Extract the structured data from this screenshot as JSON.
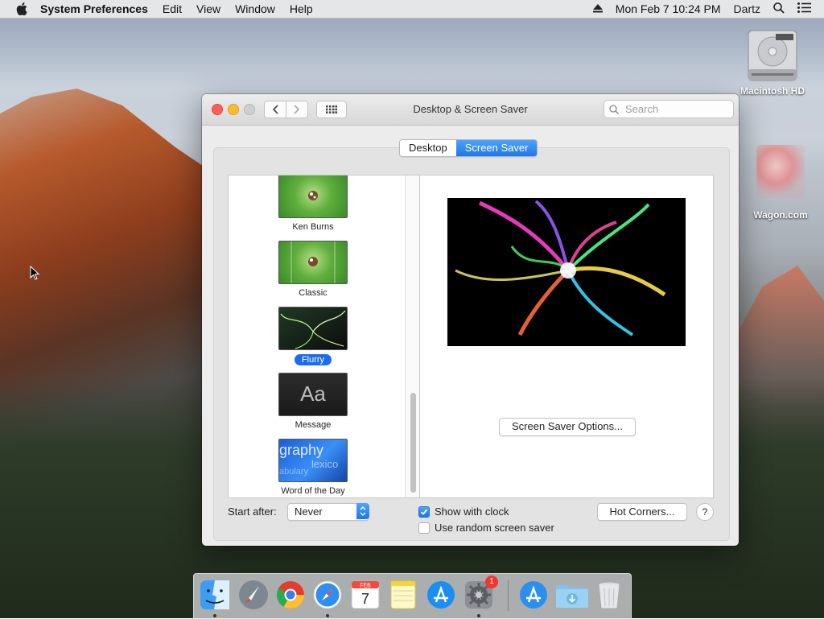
{
  "menubar": {
    "app_name": "System Preferences",
    "menus": [
      "Edit",
      "View",
      "Window",
      "Help"
    ],
    "datetime": "Mon Feb 7  10:24 PM",
    "user": "Dartz"
  },
  "desktop": {
    "icons": [
      {
        "label": "Macintosh HD"
      },
      {
        "label": "Wagon.com"
      }
    ]
  },
  "window": {
    "title": "Desktop & Screen Saver",
    "search_placeholder": "Search",
    "tabs": [
      {
        "label": "Desktop",
        "selected": false
      },
      {
        "label": "Screen Saver",
        "selected": true
      }
    ],
    "savers": [
      {
        "label": "Ken Burns",
        "selected": false
      },
      {
        "label": "Classic",
        "selected": false
      },
      {
        "label": "Flurry",
        "selected": true
      },
      {
        "label": "Message",
        "selected": false,
        "thumb_text": "Aa"
      },
      {
        "label": "Word of the Day",
        "selected": false,
        "thumb_words": [
          "graphy",
          "lexico",
          "abulary"
        ]
      }
    ],
    "options_button": "Screen Saver Options...",
    "start_after_label": "Start after:",
    "start_after_value": "Never",
    "show_with_clock": {
      "label": "Show with clock",
      "checked": true
    },
    "random_saver": {
      "label": "Use random screen saver",
      "checked": false
    },
    "hot_corners_button": "Hot Corners...",
    "help_button": "?"
  },
  "dock": {
    "items": [
      "Finder",
      "Launchpad",
      "Chrome",
      "Safari",
      "Calendar",
      "Notes",
      "App Store",
      "System Preferences",
      "Applications",
      "Downloads",
      "Trash"
    ],
    "calendar_month": "FEB",
    "calendar_day": "7",
    "sysprefs_badge": "1"
  },
  "colors": {
    "accent": "#1c6ee8",
    "close": "#fc5f57",
    "minimize": "#fdbc2e"
  }
}
